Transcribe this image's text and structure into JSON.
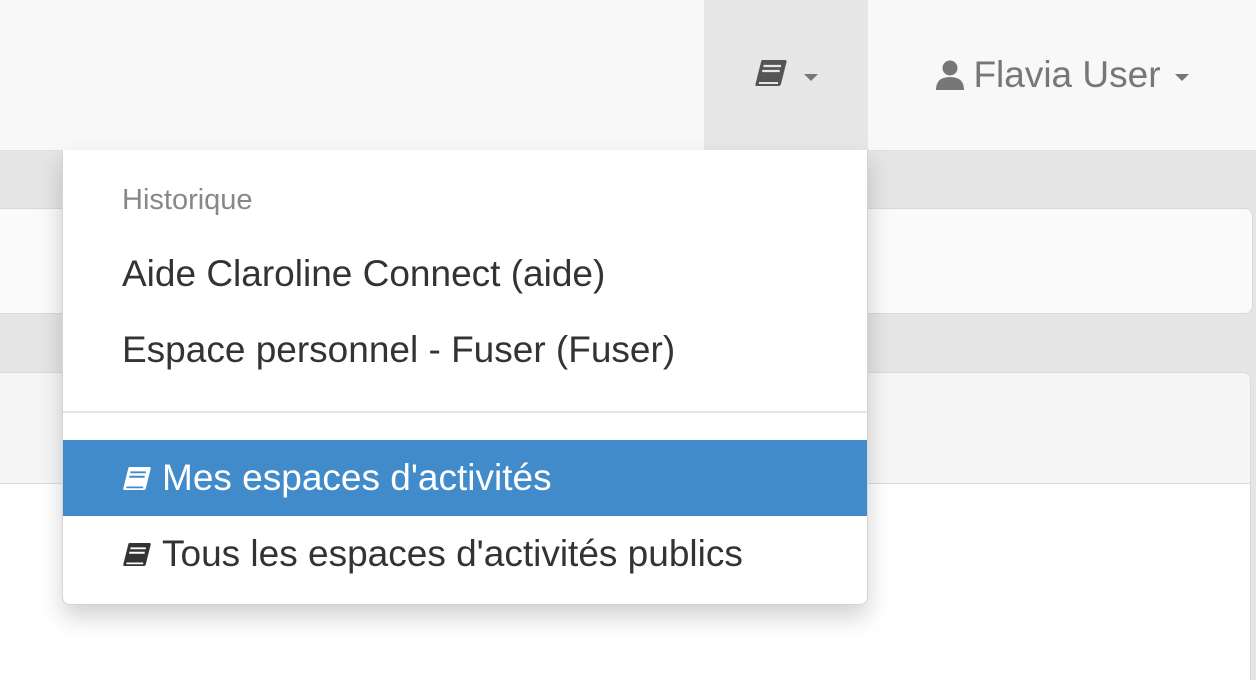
{
  "navbar": {
    "workspaces_menu": {
      "icon": "book-icon"
    },
    "user_menu": {
      "icon": "user-icon",
      "label": "Flavia User"
    }
  },
  "dropdown": {
    "header": "Historique",
    "history_items": [
      {
        "label": "Aide Claroline Connect (aide)"
      },
      {
        "label": "Espace personnel - Fuser (Fuser)"
      }
    ],
    "workspace_items": [
      {
        "icon": "book-icon",
        "label": "Mes espaces d'activités",
        "active": true
      },
      {
        "icon": "book-icon",
        "label": "Tous les espaces d'activités publics",
        "active": false
      }
    ]
  },
  "colors": {
    "active_item": "#428bca",
    "navbar": "#f8f8f8",
    "navbar_active": "#e7e7e7"
  }
}
